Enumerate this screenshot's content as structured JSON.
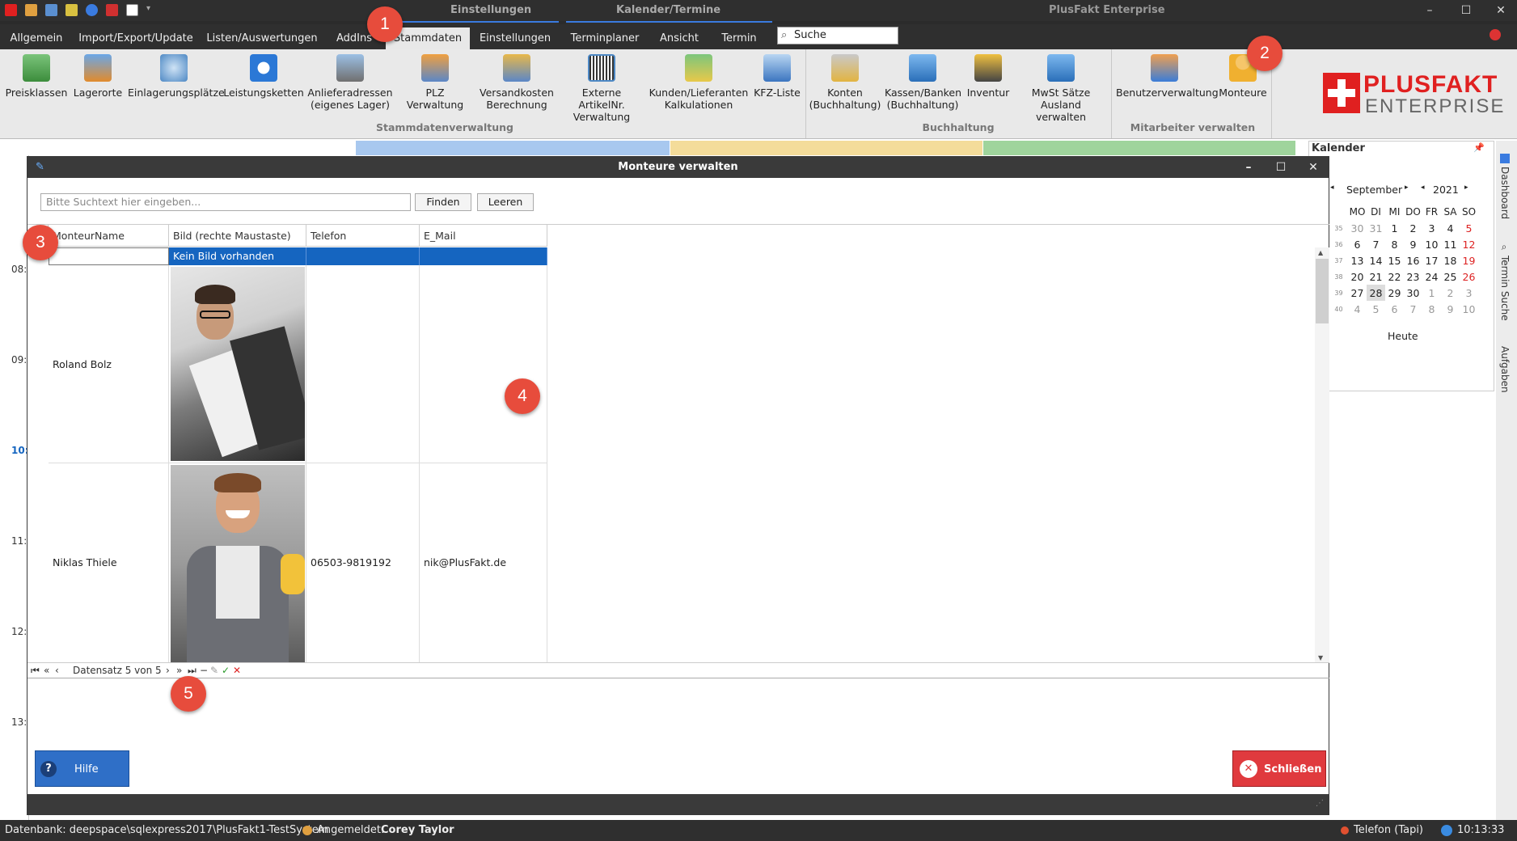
{
  "app": {
    "context_tab_einstellungen": "Einstellungen",
    "context_tab_kalender": "Kalender/Termine",
    "title": "PlusFakt Enterprise"
  },
  "menu": {
    "tabs": [
      "Allgemein",
      "Import/Export/Update",
      "Listen/Auswertungen",
      "AddIns",
      "Stammdaten",
      "Einstellungen",
      "Terminplaner",
      "Ansicht",
      "Termin"
    ],
    "search_placeholder": "Suche"
  },
  "ribbon": {
    "stammdaten": [
      {
        "label": "Preisklassen",
        "icon": "price-classes-icon"
      },
      {
        "label": "Lagerorte",
        "icon": "warehouse-icon"
      },
      {
        "label": "Einlagerungsplätze",
        "icon": "storage-location-icon"
      },
      {
        "label": "Leistungsketten",
        "icon": "chain-icon"
      },
      {
        "label": "Anlieferadressen\n(eigenes Lager)",
        "icon": "delivery-address-icon"
      },
      {
        "label": "PLZ Verwaltung",
        "icon": "zip-house-icon"
      },
      {
        "label": "Versandkosten\nBerechnung",
        "icon": "shipping-cost-icon"
      },
      {
        "label": "Externe ArtikelNr.\nVerwaltung",
        "icon": "barcode-icon"
      },
      {
        "label": "Kunden/Lieferanten\nKalkulationen",
        "icon": "customer-calc-icon"
      },
      {
        "label": "KFZ-Liste",
        "icon": "car-list-icon"
      }
    ],
    "stammdaten_group": "Stammdatenverwaltung",
    "buchhaltung": [
      {
        "label": "Konten\n(Buchhaltung)",
        "icon": "accounts-icon"
      },
      {
        "label": "Kassen/Banken\n(Buchhaltung)",
        "icon": "cash-register-icon"
      },
      {
        "label": "Inventur",
        "icon": "forklift-icon"
      },
      {
        "label": "MwSt Sätze\nAusland verwalten",
        "icon": "vat-icon"
      }
    ],
    "buchhaltung_group": "Buchhaltung",
    "mitarbeiter": [
      {
        "label": "Benutzerverwaltung",
        "icon": "user-admin-icon"
      },
      {
        "label": "Monteure",
        "icon": "mechanic-icon"
      }
    ],
    "mitarbeiter_group": "Mitarbeiter verwalten",
    "logo_top": "PLUSFAKT",
    "logo_bottom": "ENTERPRISE"
  },
  "badges": [
    "1",
    "2",
    "3",
    "4",
    "5"
  ],
  "background": {
    "times": [
      "08:",
      "09:",
      "10:",
      "11:",
      "12:",
      "13:"
    ]
  },
  "calendar": {
    "title": "Kalender",
    "month": "September",
    "year": "2021",
    "weekdays": [
      "MO",
      "DI",
      "MI",
      "DO",
      "FR",
      "SA",
      "SO"
    ],
    "weeks": [
      {
        "kw": "35",
        "days": [
          "30",
          "31",
          "1",
          "2",
          "3",
          "4",
          "5"
        ]
      },
      {
        "kw": "36",
        "days": [
          "6",
          "7",
          "8",
          "9",
          "10",
          "11",
          "12"
        ]
      },
      {
        "kw": "37",
        "days": [
          "13",
          "14",
          "15",
          "16",
          "17",
          "18",
          "19"
        ]
      },
      {
        "kw": "38",
        "days": [
          "20",
          "21",
          "22",
          "23",
          "24",
          "25",
          "26"
        ]
      },
      {
        "kw": "39",
        "days": [
          "27",
          "28",
          "29",
          "30",
          "1",
          "2",
          "3"
        ]
      },
      {
        "kw": "40",
        "days": [
          "4",
          "5",
          "6",
          "7",
          "8",
          "9",
          "10"
        ]
      }
    ],
    "today_label": "Heute",
    "side_tabs": [
      "Dashboard",
      "Termin Suche",
      "Aufgaben"
    ]
  },
  "dialog": {
    "title": "Monteure verwalten",
    "search_placeholder": "Bitte Suchtext hier eingeben...",
    "find_label": "Finden",
    "clear_label": "Leeren",
    "columns": [
      "MonteurName",
      "Bild (rechte Maustaste)",
      "Telefon",
      "E_Mail"
    ],
    "new_row": {
      "name": "",
      "bild": "Kein Bild vorhanden",
      "telefon": "",
      "email": ""
    },
    "rows": [
      {
        "name": "Roland Bolz",
        "telefon": "",
        "email": ""
      },
      {
        "name": "Niklas Thiele",
        "telefon": "06503-9819192",
        "email": "nik@PlusFakt.de"
      }
    ],
    "navigator": "Datensatz 5 von 5",
    "help_label": "Hilfe",
    "close_label": "Schließen"
  },
  "status": {
    "database": "Datenbank: deepspace\\sqlexpress2017\\PlusFakt1-TestSystem",
    "logged_in_label": "Angemeldet:",
    "user": "Corey Taylor",
    "phone": "Telefon (Tapi)",
    "time": "10:13:33"
  },
  "colors": {
    "accent": "#1565c0",
    "badge": "#e74c3c",
    "close_button": "#e03a3e",
    "help_button": "#2f6fc7"
  }
}
